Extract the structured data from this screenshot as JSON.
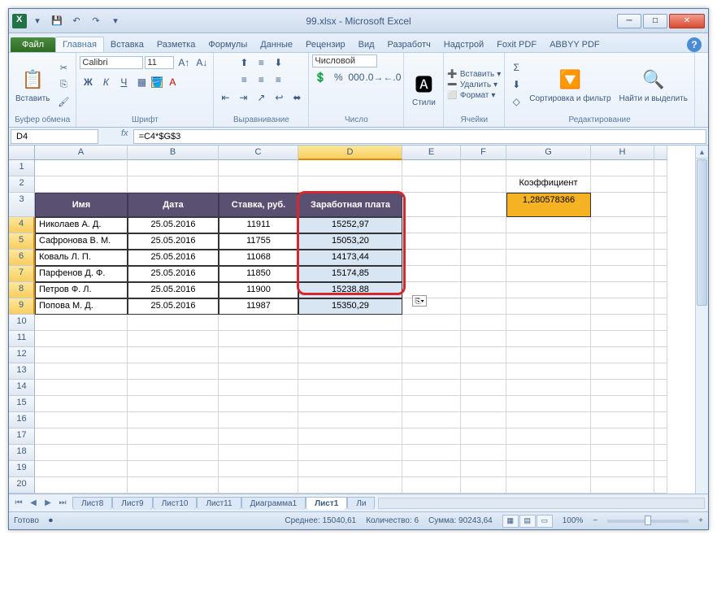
{
  "title": "99.xlsx - Microsoft Excel",
  "qat": {
    "save": "💾",
    "undo": "↶",
    "redo": "↷"
  },
  "tabs": {
    "file": "Файл",
    "items": [
      "Главная",
      "Вставка",
      "Разметка",
      "Формулы",
      "Данные",
      "Рецензир",
      "Вид",
      "Разработч",
      "Надстрой",
      "Foxit PDF",
      "ABBYY PDF"
    ],
    "active": 0
  },
  "ribbon": {
    "clipboard": {
      "label": "Буфер обмена",
      "paste": "Вставить"
    },
    "font": {
      "label": "Шрифт",
      "name": "Calibri",
      "size": "11"
    },
    "align": {
      "label": "Выравнивание"
    },
    "number": {
      "label": "Число",
      "format": "Числовой"
    },
    "styles": {
      "label": "Стили",
      "btn": "Стили"
    },
    "cells": {
      "label": "Ячейки",
      "insert": "Вставить",
      "delete": "Удалить",
      "format": "Формат"
    },
    "editing": {
      "label": "Редактирование",
      "sort": "Сортировка и фильтр",
      "find": "Найти и выделить"
    }
  },
  "namebox": "D4",
  "formula": "=C4*$G$3",
  "columns": [
    "A",
    "B",
    "C",
    "D",
    "E",
    "F",
    "G",
    "H"
  ],
  "rows_empty": [
    "10",
    "11",
    "12",
    "13",
    "14",
    "15",
    "16",
    "17",
    "18",
    "19",
    "20"
  ],
  "table": {
    "headers": [
      "Имя",
      "Дата",
      "Ставка, руб.",
      "Заработная плата"
    ],
    "rows": [
      {
        "n": "4",
        "name": "Николаев А. Д.",
        "date": "25.05.2016",
        "rate": "11911",
        "salary": "15252,97"
      },
      {
        "n": "5",
        "name": "Сафронова В. М.",
        "date": "25.05.2016",
        "rate": "11755",
        "salary": "15053,20"
      },
      {
        "n": "6",
        "name": "Коваль Л. П.",
        "date": "25.05.2016",
        "rate": "11068",
        "salary": "14173,44"
      },
      {
        "n": "7",
        "name": "Парфенов Д. Ф.",
        "date": "25.05.2016",
        "rate": "11850",
        "salary": "15174,85"
      },
      {
        "n": "8",
        "name": "Петров Ф. Л.",
        "date": "25.05.2016",
        "rate": "11900",
        "salary": "15238,88"
      },
      {
        "n": "9",
        "name": "Попова М. Д.",
        "date": "25.05.2016",
        "rate": "11987",
        "salary": "15350,29"
      }
    ]
  },
  "coef": {
    "label": "Коэффициент",
    "value": "1,280578366"
  },
  "sheets": [
    "Лист8",
    "Лист9",
    "Лист10",
    "Лист11",
    "Диаграмма1",
    "Лист1",
    "Ли"
  ],
  "sheets_active": 5,
  "status": {
    "ready": "Готово",
    "avg": "Среднее: 15040,61",
    "count": "Количество: 6",
    "sum": "Сумма: 90243,64",
    "zoom": "100%"
  }
}
